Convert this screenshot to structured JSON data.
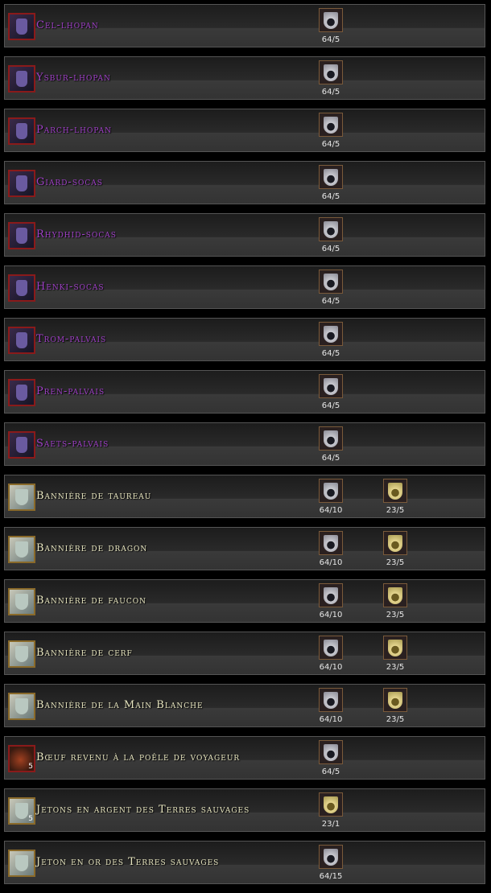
{
  "colors": {
    "purple_text": "#a040c8",
    "gold_text": "#e8e6c0"
  },
  "rows": [
    {
      "name": "Cel-lhopan",
      "icon": "boots-icon",
      "color": "#a040c8",
      "costs": [
        {
          "icon": "silver-token-icon",
          "label": "64/5"
        }
      ]
    },
    {
      "name": "Ysbur-lhopan",
      "icon": "boots-icon",
      "color": "#a040c8",
      "costs": [
        {
          "icon": "silver-token-icon",
          "label": "64/5"
        }
      ]
    },
    {
      "name": "Parch-lhopan",
      "icon": "boots-icon",
      "color": "#a040c8",
      "costs": [
        {
          "icon": "silver-token-icon",
          "label": "64/5"
        }
      ]
    },
    {
      "name": "Giard-socas",
      "icon": "leggings-icon",
      "color": "#a040c8",
      "costs": [
        {
          "icon": "silver-token-icon",
          "label": "64/5"
        }
      ]
    },
    {
      "name": "Rhydhid-socas",
      "icon": "leggings-icon",
      "color": "#a040c8",
      "costs": [
        {
          "icon": "silver-token-icon",
          "label": "64/5"
        }
      ]
    },
    {
      "name": "Henki-socas",
      "icon": "leggings-icon",
      "color": "#a040c8",
      "costs": [
        {
          "icon": "silver-token-icon",
          "label": "64/5"
        }
      ]
    },
    {
      "name": "Trom-palvais",
      "icon": "gloves-icon",
      "color": "#a040c8",
      "costs": [
        {
          "icon": "silver-token-icon",
          "label": "64/5"
        }
      ]
    },
    {
      "name": "Pren-palvais",
      "icon": "gloves-icon",
      "color": "#a040c8",
      "costs": [
        {
          "icon": "silver-token-icon",
          "label": "64/5"
        }
      ]
    },
    {
      "name": "Saets-palvais",
      "icon": "gloves-icon",
      "color": "#a040c8",
      "costs": [
        {
          "icon": "silver-token-icon",
          "label": "64/5"
        }
      ]
    },
    {
      "name": "Bannière de taureau",
      "icon": "banner-icon",
      "color": "#e8e6c0",
      "costs": [
        {
          "icon": "silver-token-icon",
          "label": "64/10"
        },
        {
          "icon": "gold-token-icon",
          "label": "23/5"
        }
      ]
    },
    {
      "name": "Bannière de dragon",
      "icon": "banner-icon",
      "color": "#e8e6c0",
      "costs": [
        {
          "icon": "silver-token-icon",
          "label": "64/10"
        },
        {
          "icon": "gold-token-icon",
          "label": "23/5"
        }
      ]
    },
    {
      "name": "Bannière de faucon",
      "icon": "banner-icon",
      "color": "#e8e6c0",
      "costs": [
        {
          "icon": "silver-token-icon",
          "label": "64/10"
        },
        {
          "icon": "gold-token-icon",
          "label": "23/5"
        }
      ]
    },
    {
      "name": "Bannière de cerf",
      "icon": "banner-icon",
      "color": "#e8e6c0",
      "costs": [
        {
          "icon": "silver-token-icon",
          "label": "64/10"
        },
        {
          "icon": "gold-token-icon",
          "label": "23/5"
        }
      ]
    },
    {
      "name": "Bannière de la Main Blanche",
      "icon": "banner-icon",
      "color": "#e8e6c0",
      "costs": [
        {
          "icon": "silver-token-icon",
          "label": "64/10"
        },
        {
          "icon": "gold-token-icon",
          "label": "23/5"
        }
      ]
    },
    {
      "name": "Bœuf revenu à la poêle de voyageur",
      "icon": "food-icon",
      "qty": "5",
      "color": "#e8e6c0",
      "costs": [
        {
          "icon": "silver-token-icon",
          "label": "64/5"
        }
      ]
    },
    {
      "name": "Jetons en argent des Terres sauvages",
      "icon": "silver-token-icon",
      "qty": "5",
      "color": "#e8e6c0",
      "costs": [
        {
          "icon": "gold-token-icon",
          "label": "23/1"
        }
      ]
    },
    {
      "name": "Jeton en or des Terres sauvages",
      "icon": "gold-token-icon",
      "color": "#e8e6c0",
      "costs": [
        {
          "icon": "silver-token-icon",
          "label": "64/15"
        }
      ]
    }
  ]
}
